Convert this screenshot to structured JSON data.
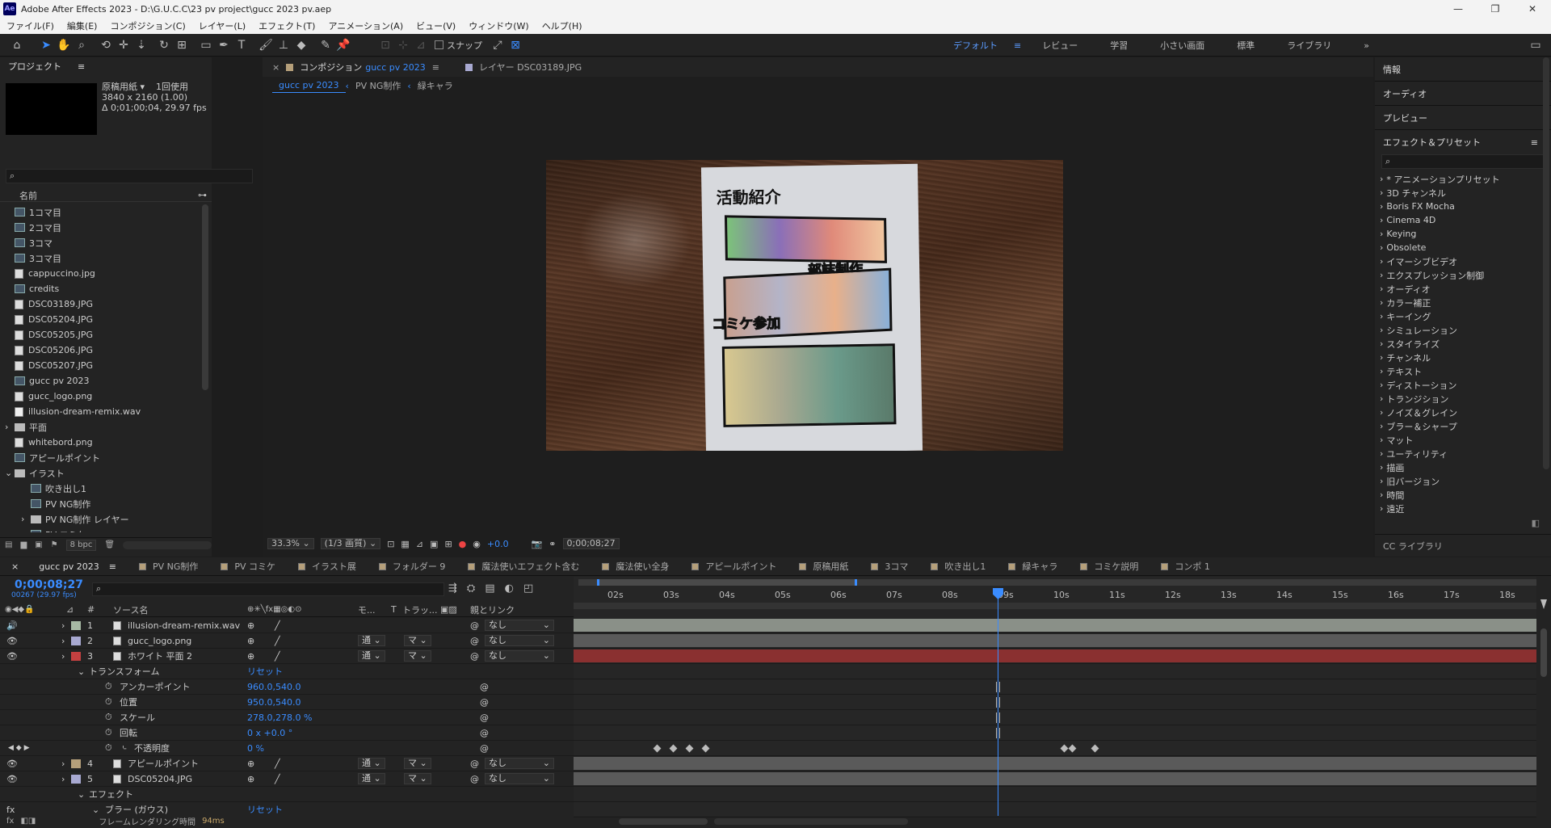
{
  "window": {
    "title": "Adobe After Effects 2023 - D:\\G.U.C.C\\23 pv project\\gucc 2023 pv.aep",
    "minimize": "—",
    "maximize": "❐",
    "close": "✕"
  },
  "menu": [
    "ファイル(F)",
    "編集(E)",
    "コンポジション(C)",
    "レイヤー(L)",
    "エフェクト(T)",
    "アニメーション(A)",
    "ビュー(V)",
    "ウィンドウ(W)",
    "ヘルプ(H)"
  ],
  "toolbar": {
    "snap_label": "スナップ"
  },
  "workspaces": [
    "デフォルト",
    "レビュー",
    "学習",
    "小さい画面",
    "標準",
    "ライブラリ"
  ],
  "workspace_more": "»",
  "project": {
    "panel_title": "プロジェクト",
    "selected_name": "原稿用紙 ▾",
    "usage": "1回使用",
    "info_size": "3840 x 2160 (1.00)",
    "info_duration": "Δ 0;01;00;04, 29.97 fps",
    "column_name": "名前",
    "bpc": "8 bpc",
    "items": [
      {
        "label": "1コマ目",
        "icon": "comp",
        "indent": 0
      },
      {
        "label": "2コマ目",
        "icon": "comp",
        "indent": 0
      },
      {
        "label": "3コマ",
        "icon": "comp",
        "indent": 0
      },
      {
        "label": "3コマ目",
        "icon": "comp",
        "indent": 0
      },
      {
        "label": "cappuccino.jpg",
        "icon": "img",
        "indent": 0
      },
      {
        "label": "credits",
        "icon": "comp",
        "indent": 0
      },
      {
        "label": "DSC03189.JPG",
        "icon": "img",
        "indent": 0
      },
      {
        "label": "DSC05204.JPG",
        "icon": "img",
        "indent": 0
      },
      {
        "label": "DSC05205.JPG",
        "icon": "img",
        "indent": 0
      },
      {
        "label": "DSC05206.JPG",
        "icon": "img",
        "indent": 0
      },
      {
        "label": "DSC05207.JPG",
        "icon": "img",
        "indent": 0
      },
      {
        "label": "gucc pv 2023",
        "icon": "comp",
        "indent": 0
      },
      {
        "label": "gucc_logo.png",
        "icon": "img",
        "indent": 0
      },
      {
        "label": "illusion-dream-remix.wav",
        "icon": "aud",
        "indent": 0
      },
      {
        "label": "平面",
        "icon": "fold",
        "indent": 0,
        "arrow": "›"
      },
      {
        "label": "whitebord.png",
        "icon": "img",
        "indent": 0
      },
      {
        "label": "アピールポイント",
        "icon": "comp",
        "indent": 0
      },
      {
        "label": "イラスト",
        "icon": "fold",
        "indent": 0,
        "arrow": "⌄"
      },
      {
        "label": "吹き出し1",
        "icon": "comp",
        "indent": 1
      },
      {
        "label": "PV NG制作",
        "icon": "comp",
        "indent": 1
      },
      {
        "label": "PV NG制作 レイヤー",
        "icon": "fold",
        "indent": 1,
        "arrow": "›"
      },
      {
        "label": "PV コミケ",
        "icon": "comp",
        "indent": 1
      }
    ]
  },
  "viewer": {
    "tab_comp_prefix": "コンポジション",
    "tab_comp_name": "gucc pv 2023",
    "tab_layer": "レイヤー DSC03189.JPG",
    "crumbs": [
      "gucc pv 2023",
      "PV NG制作",
      "緑キャラ"
    ],
    "zoom": "33.3%",
    "quality": "(1/3 画質)",
    "exposure": "+0.0",
    "timecode": "0;00;08;27",
    "poster_title": "活動紹介",
    "poster_label_1": "部誌制作",
    "poster_label_2": "コミケ参加"
  },
  "right": {
    "info": "情報",
    "audio": "オーディオ",
    "preview": "プレビュー",
    "effects_title": "エフェクト＆プリセット",
    "effects": [
      "* アニメーションプリセット",
      "3D チャンネル",
      "Boris FX Mocha",
      "Cinema 4D",
      "Keying",
      "Obsolete",
      "イマーシブビデオ",
      "エクスプレッション制御",
      "オーディオ",
      "カラー補正",
      "キーイング",
      "シミュレーション",
      "スタイライズ",
      "チャンネル",
      "テキスト",
      "ディストーション",
      "トランジション",
      "ノイズ＆グレイン",
      "ブラー＆シャープ",
      "マット",
      "ユーティリティ",
      "描画",
      "旧バージョン",
      "時間",
      "遠近"
    ],
    "cc_libraries": "CC ライブラリ"
  },
  "timeline": {
    "tabs": [
      {
        "label": "gucc pv 2023",
        "color": "#8a8a8a"
      },
      {
        "label": "PV NG制作",
        "color": "#b59f7a"
      },
      {
        "label": "PV コミケ",
        "color": "#b59f7a"
      },
      {
        "label": "イラスト展",
        "color": "#b59f7a"
      },
      {
        "label": "フォルダー 9",
        "color": "#b59f7a"
      },
      {
        "label": "魔法使いエフェクト含む",
        "color": "#b59f7a"
      },
      {
        "label": "魔法使い全身",
        "color": "#b59f7a"
      },
      {
        "label": "アピールポイント",
        "color": "#b59f7a"
      },
      {
        "label": "原稿用紙",
        "color": "#b59f7a"
      },
      {
        "label": "3コマ",
        "color": "#b59f7a"
      },
      {
        "label": "吹き出し1",
        "color": "#b59f7a"
      },
      {
        "label": "緑キャラ",
        "color": "#b59f7a"
      },
      {
        "label": "コミケ説明",
        "color": "#b59f7a"
      },
      {
        "label": "コンポ 1",
        "color": "#b59f7a"
      }
    ],
    "timecode": "0;00;08;27",
    "frames": "00267 (29.97 fps)",
    "col_hash": "#",
    "col_source": "ソース名",
    "col_mode": "モ...",
    "col_t": "T",
    "col_track": "トラッ...",
    "col_parent": "親とリンク",
    "ruler": [
      "02s",
      "03s",
      "04s",
      "05s",
      "06s",
      "07s",
      "08s",
      "09s",
      "10s",
      "11s",
      "12s",
      "13s",
      "14s",
      "15s",
      "16s",
      "17s",
      "18s"
    ],
    "layers": [
      {
        "num": "1",
        "name": "illusion-dream-remix.wav",
        "color": "#a7b9a4",
        "parent": "なし"
      },
      {
        "num": "2",
        "name": "gucc_logo.png",
        "color": "#a8a9d1",
        "parent": "なし"
      },
      {
        "num": "3",
        "name": "ホワイト 平面 2",
        "color": "#c44040",
        "parent": "なし"
      }
    ],
    "transform": {
      "label": "トランスフォーム",
      "reset": "リセット"
    },
    "props": [
      {
        "name": "アンカーポイント",
        "value": "960.0,540.0"
      },
      {
        "name": "位置",
        "value": "950.0,540.0"
      },
      {
        "name": "スケール",
        "value": "278.0,278.0 %"
      },
      {
        "name": "回転",
        "value": "0 x +0.0 °"
      },
      {
        "name": "不透明度",
        "value": "0 %"
      }
    ],
    "layers2": [
      {
        "num": "4",
        "name": "アピールポイント",
        "color": "#b59f7a",
        "parent": "なし"
      },
      {
        "num": "5",
        "name": "DSC05204.JPG",
        "color": "#a8a9d1",
        "parent": "なし"
      }
    ],
    "effect_label": "エフェクト",
    "blur_label": "ブラー (ガウス)",
    "blur_reset": "リセット",
    "mode_value": "通",
    "track_value": "マ",
    "render_label": "フレームレンダリング時間",
    "render_value": "94ms"
  }
}
